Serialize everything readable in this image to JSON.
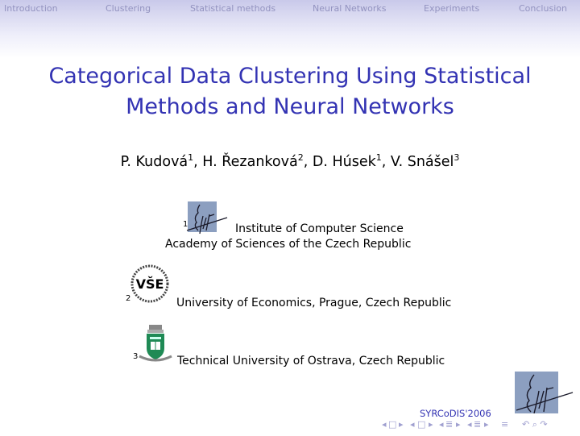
{
  "nav": {
    "sections": [
      "Introduction",
      "Clustering",
      "Statistical methods",
      "Neural Networks",
      "Experiments",
      "Conclusion"
    ]
  },
  "title": {
    "line1": "Categorical Data Clustering Using Statistical",
    "line2": "Methods and Neural Networks"
  },
  "authors": [
    {
      "name": "P. Kudová",
      "affil": "1"
    },
    {
      "name": "H. Řezanková",
      "affil": "2"
    },
    {
      "name": "D. Húsek",
      "affil": "1"
    },
    {
      "name": "V. Snášel",
      "affil": "3"
    }
  ],
  "affiliations": [
    {
      "num": "1",
      "line1": "Institute of Computer Science",
      "line2": "Academy of Sciences of the Czech Republic",
      "logo": "ics-logo"
    },
    {
      "num": "2",
      "line1": "University of Economics, Prague, Czech Republic",
      "logo": "vse-logo"
    },
    {
      "num": "3",
      "line1": "Technical University of Ostrava, Czech Republic",
      "logo": "vsb-logo"
    }
  ],
  "footer": {
    "conference": "SYRCoDIS'2006",
    "separators": [
      ", ",
      ", ",
      ", "
    ]
  },
  "nav_symbols": {
    "left": "◂",
    "right": "▸",
    "frame": "□",
    "subsection": "≣",
    "section": "≣",
    "align": "≡",
    "undo_back_forward": "↶ ⌕ ↷"
  },
  "colors": {
    "title": "#3333b3",
    "nav_text": "#9393c0",
    "header_top": "#c9c9ea",
    "logo_bg": "#8c9fc0",
    "vsb_green": "#1f8a55"
  }
}
